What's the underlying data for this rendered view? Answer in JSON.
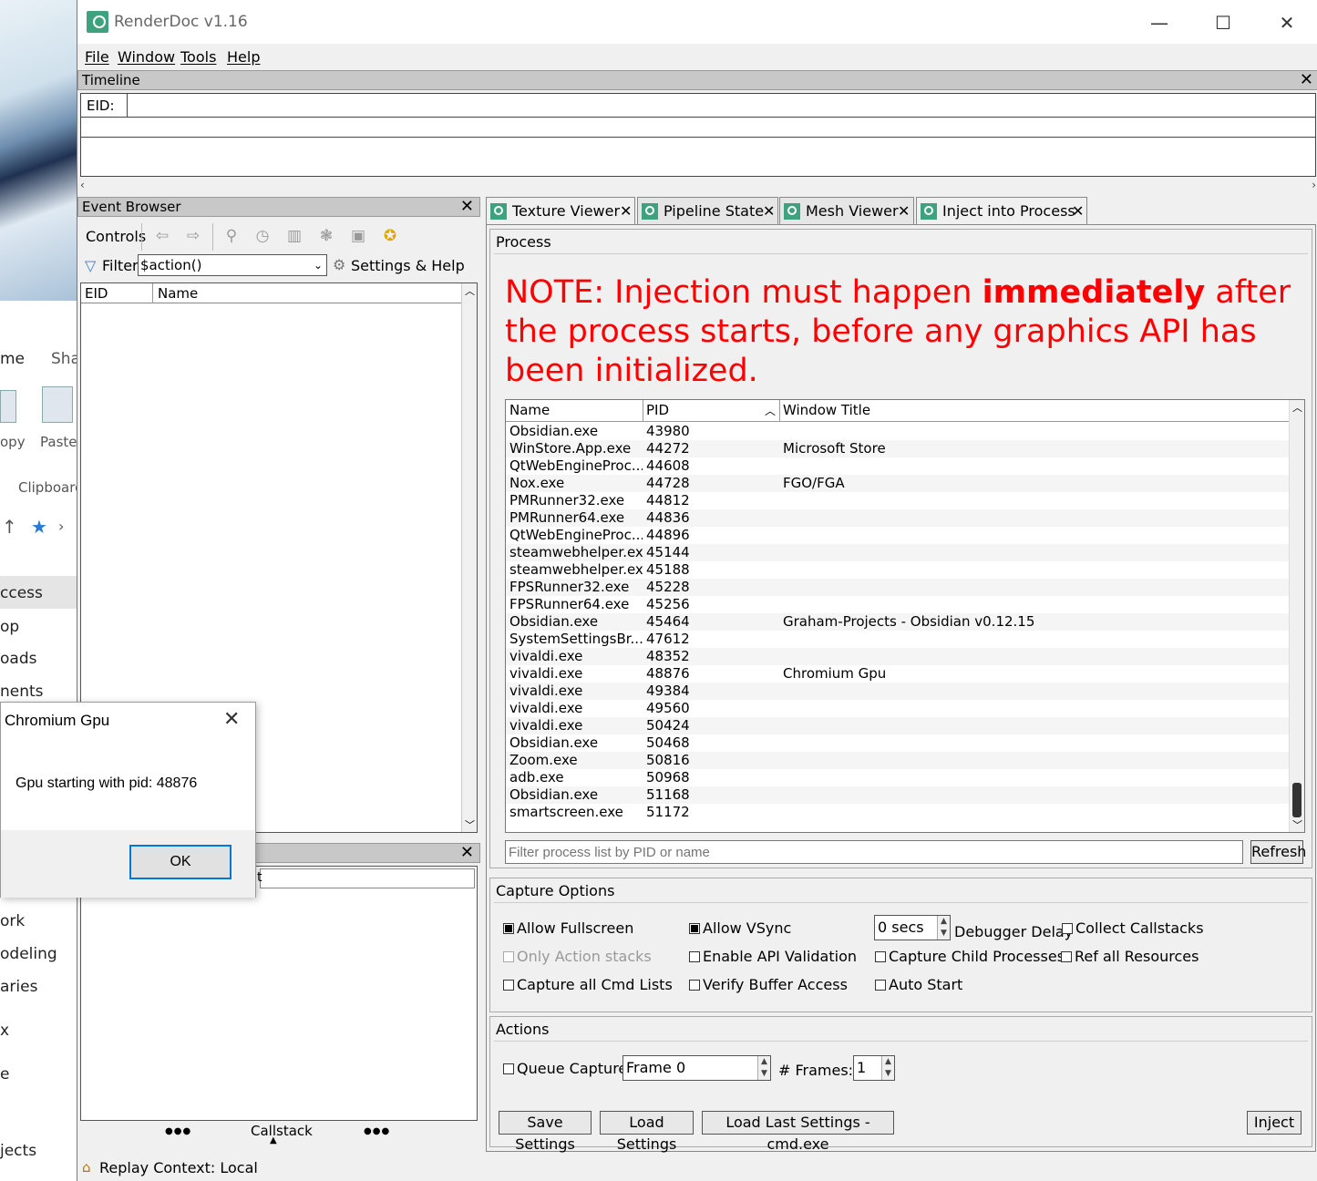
{
  "window": {
    "title": "RenderDoc v1.16",
    "minimize": "—",
    "maximize": "☐",
    "close": "✕"
  },
  "menu": [
    "File",
    "Window",
    "Tools",
    "Help"
  ],
  "timeline": {
    "title": "Timeline",
    "eid_label": "EID:",
    "close": "✕"
  },
  "event_browser": {
    "title": "Event Browser",
    "controls_label": "Controls",
    "filter_label": "Filter",
    "filter_value": "$action()",
    "settings_label": "Settings & Help",
    "columns": [
      "EID",
      "Name"
    ],
    "close": "✕"
  },
  "bottom_left": {
    "close": "✕",
    "partial_text": "t",
    "callstack_label": "Callstack",
    "dots": "●●●"
  },
  "status": {
    "text": "Replay Context: Local"
  },
  "tabs": [
    {
      "label": "Texture Viewer"
    },
    {
      "label": "Pipeline State"
    },
    {
      "label": "Mesh Viewer"
    },
    {
      "label": "Inject into Process"
    }
  ],
  "process": {
    "group_title": "Process",
    "note_pre": "NOTE: Injection must happen ",
    "note_bold": "immediately",
    "note_post": " after the process starts, before any graphics API has been initialized.",
    "columns": [
      "Name",
      "PID",
      "Window Title"
    ],
    "rows": [
      {
        "name": "Obsidian.exe",
        "pid": "43980",
        "title": ""
      },
      {
        "name": "WinStore.App.exe",
        "pid": "44272",
        "title": "Microsoft Store"
      },
      {
        "name": "QtWebEngineProc...",
        "pid": "44608",
        "title": ""
      },
      {
        "name": "Nox.exe",
        "pid": "44728",
        "title": "FGO/FGA"
      },
      {
        "name": "PMRunner32.exe",
        "pid": "44812",
        "title": ""
      },
      {
        "name": "PMRunner64.exe",
        "pid": "44836",
        "title": ""
      },
      {
        "name": "QtWebEngineProc...",
        "pid": "44896",
        "title": ""
      },
      {
        "name": "steamwebhelper.exe",
        "pid": "45144",
        "title": ""
      },
      {
        "name": "steamwebhelper.exe",
        "pid": "45188",
        "title": ""
      },
      {
        "name": "FPSRunner32.exe",
        "pid": "45228",
        "title": ""
      },
      {
        "name": "FPSRunner64.exe",
        "pid": "45256",
        "title": ""
      },
      {
        "name": "Obsidian.exe",
        "pid": "45464",
        "title": "Graham-Projects - Obsidian v0.12.15"
      },
      {
        "name": "SystemSettingsBr...",
        "pid": "47612",
        "title": ""
      },
      {
        "name": "vivaldi.exe",
        "pid": "48352",
        "title": ""
      },
      {
        "name": "vivaldi.exe",
        "pid": "48876",
        "title": "Chromium Gpu"
      },
      {
        "name": "vivaldi.exe",
        "pid": "49384",
        "title": ""
      },
      {
        "name": "vivaldi.exe",
        "pid": "49560",
        "title": ""
      },
      {
        "name": "vivaldi.exe",
        "pid": "50424",
        "title": ""
      },
      {
        "name": "Obsidian.exe",
        "pid": "50468",
        "title": ""
      },
      {
        "name": "Zoom.exe",
        "pid": "50816",
        "title": ""
      },
      {
        "name": "adb.exe",
        "pid": "50968",
        "title": ""
      },
      {
        "name": "Obsidian.exe",
        "pid": "51168",
        "title": ""
      },
      {
        "name": "smartscreen.exe",
        "pid": "51172",
        "title": ""
      }
    ],
    "filter_placeholder": "Filter process list by PID or name",
    "refresh_label": "Refresh"
  },
  "capture_options": {
    "title": "Capture Options",
    "allow_fullscreen": "Allow Fullscreen",
    "allow_vsync": "Allow VSync",
    "delay_value": "0 secs",
    "debugger_delay": "Debugger Delay",
    "collect_callstacks": "Collect Callstacks",
    "only_action_stacks": "Only Action stacks",
    "enable_api_validation": "Enable API Validation",
    "capture_child_processes": "Capture Child Processes",
    "ref_all_resources": "Ref all Resources",
    "capture_all_cmd_lists": "Capture all Cmd Lists",
    "verify_buffer_access": "Verify Buffer Access",
    "auto_start": "Auto Start"
  },
  "actions": {
    "title": "Actions",
    "queue_capture": "Queue Capture",
    "frame_value": "Frame 0",
    "frames_label": "# Frames:",
    "frames_value": "1",
    "save_settings": "Save Settings",
    "load_settings": "Load Settings",
    "load_last": "Load Last Settings - cmd.exe",
    "inject": "Inject"
  },
  "dialog": {
    "title": "Chromium Gpu",
    "message": "Gpu starting with pid: 48876",
    "ok": "OK",
    "close": "✕"
  },
  "explorer_bg": {
    "items": [
      "me",
      "Sha",
      "opy",
      "Paste",
      "Clipboard",
      "ccess",
      "op",
      "oads",
      "nents",
      "ork",
      "odeling",
      "aries",
      "x",
      "e",
      "jects"
    ]
  }
}
